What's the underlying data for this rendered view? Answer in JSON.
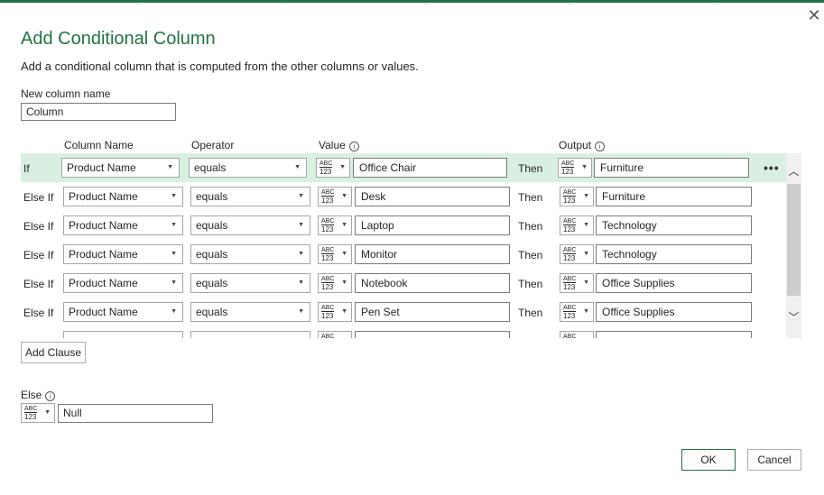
{
  "dialog": {
    "title": "Add Conditional Column",
    "subtitle": "Add a conditional column that is computed from the other columns or values.",
    "close_glyph": "✕"
  },
  "new_column": {
    "label": "New column name",
    "value": "Column"
  },
  "headers": {
    "column_name": "Column Name",
    "operator": "Operator",
    "value": "Value",
    "output": "Output",
    "info_glyph": "i"
  },
  "type_icon": {
    "top": "ABC",
    "bottom": "123"
  },
  "then_label": "Then",
  "clauses": [
    {
      "kind": "If",
      "column": "Product Name",
      "operator": "equals",
      "value": "Office Chair",
      "output": "Furniture"
    },
    {
      "kind": "Else If",
      "column": "Product Name",
      "operator": "equals",
      "value": "Desk",
      "output": "Furniture"
    },
    {
      "kind": "Else If",
      "column": "Product Name",
      "operator": "equals",
      "value": "Laptop",
      "output": "Technology"
    },
    {
      "kind": "Else If",
      "column": "Product Name",
      "operator": "equals",
      "value": "Monitor",
      "output": "Technology"
    },
    {
      "kind": "Else If",
      "column": "Product Name",
      "operator": "equals",
      "value": "Notebook",
      "output": "Office Supplies"
    },
    {
      "kind": "Else If",
      "column": "Product Name",
      "operator": "equals",
      "value": "Pen Set",
      "output": "Office Supplies"
    }
  ],
  "more_glyph": "•••",
  "scroll": {
    "up_glyph": "︿",
    "down_glyph": "﹀"
  },
  "add_clause": "Add Clause",
  "else": {
    "label": "Else",
    "value": "Null"
  },
  "buttons": {
    "ok": "OK",
    "cancel": "Cancel"
  },
  "colors": {
    "accent": "#217346",
    "selected_row": "#d9efe2"
  }
}
